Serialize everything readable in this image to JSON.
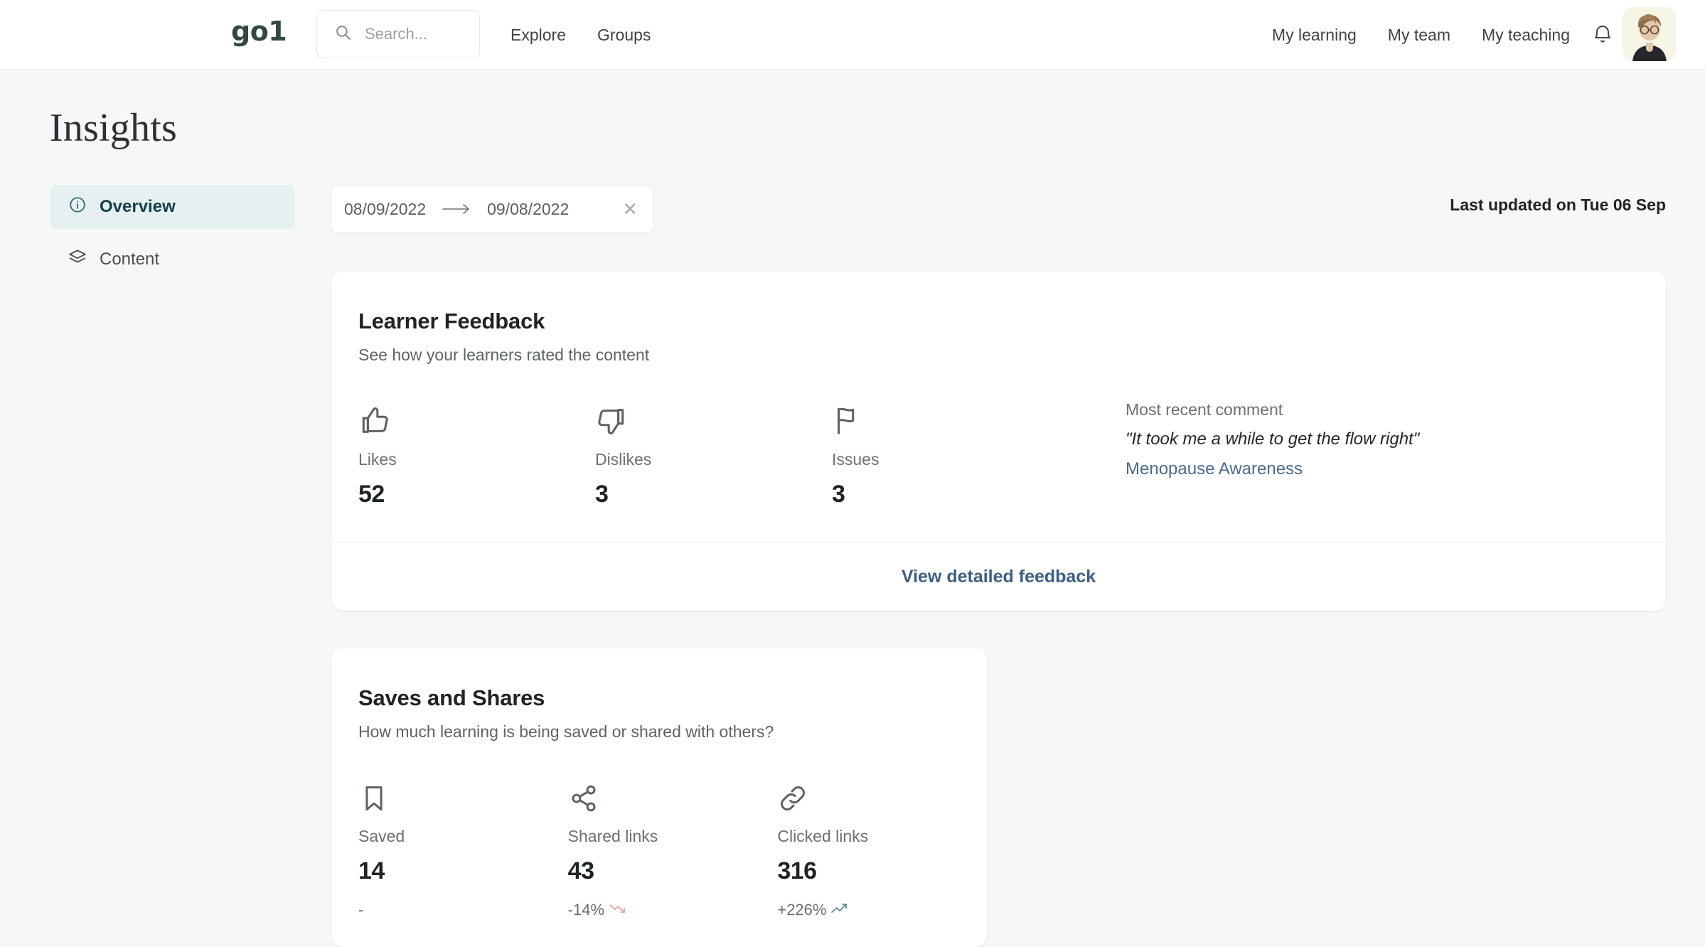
{
  "nav": {
    "brand": "go1",
    "search_placeholder": "Search...",
    "left_links": [
      "Explore",
      "Groups"
    ],
    "right_links": [
      "My learning",
      "My team",
      "My teaching"
    ],
    "bell_icon": "bell-icon",
    "avatar_icon": "user-avatar"
  },
  "page": {
    "title": "Insights"
  },
  "sidebar": {
    "items": [
      {
        "label": "Overview",
        "icon": "info-circle-icon",
        "active": true
      },
      {
        "label": "Content",
        "icon": "layers-icon",
        "active": false
      }
    ]
  },
  "daterange": {
    "from": "08/09/2022",
    "to": "09/08/2022",
    "arrow_icon": "arrow-right-icon",
    "clear_icon": "close-icon"
  },
  "status": {
    "last_updated": "Last updated on Tue 06 Sep"
  },
  "cards": {
    "feedback": {
      "title": "Learner Feedback",
      "subtitle": "See how your learners rated the content",
      "metrics": [
        {
          "icon": "thumbs-up-icon",
          "label": "Likes",
          "value": "52"
        },
        {
          "icon": "thumbs-down-icon",
          "label": "Dislikes",
          "value": "3"
        },
        {
          "icon": "flag-icon",
          "label": "Issues",
          "value": "3"
        }
      ],
      "recent": {
        "label": "Most recent comment",
        "quote": "\"It took me a while to get the flow right\"",
        "link": "Menopause Awareness"
      },
      "footer_link": "View detailed feedback"
    },
    "saves": {
      "title": "Saves and Shares",
      "subtitle": "How much learning is being saved or shared with others?",
      "metrics": [
        {
          "icon": "bookmark-icon",
          "label": "Saved",
          "value": "14",
          "delta": "-",
          "trend": "none"
        },
        {
          "icon": "share-icon",
          "label": "Shared links",
          "value": "43",
          "delta": "-14%",
          "trend": "down"
        },
        {
          "icon": "link-icon",
          "label": "Clicked links",
          "value": "316",
          "delta": "+226%",
          "trend": "up"
        }
      ]
    }
  },
  "colors": {
    "brand_green": "#33493f",
    "page_bg": "#f6f8f7",
    "active_sidebar_bg": "#e7f0f1",
    "active_sidebar_text": "#13414a",
    "link_blue": "#3d5f84",
    "trend_down": "#e8a09a",
    "trend_up": "#5b8796"
  }
}
